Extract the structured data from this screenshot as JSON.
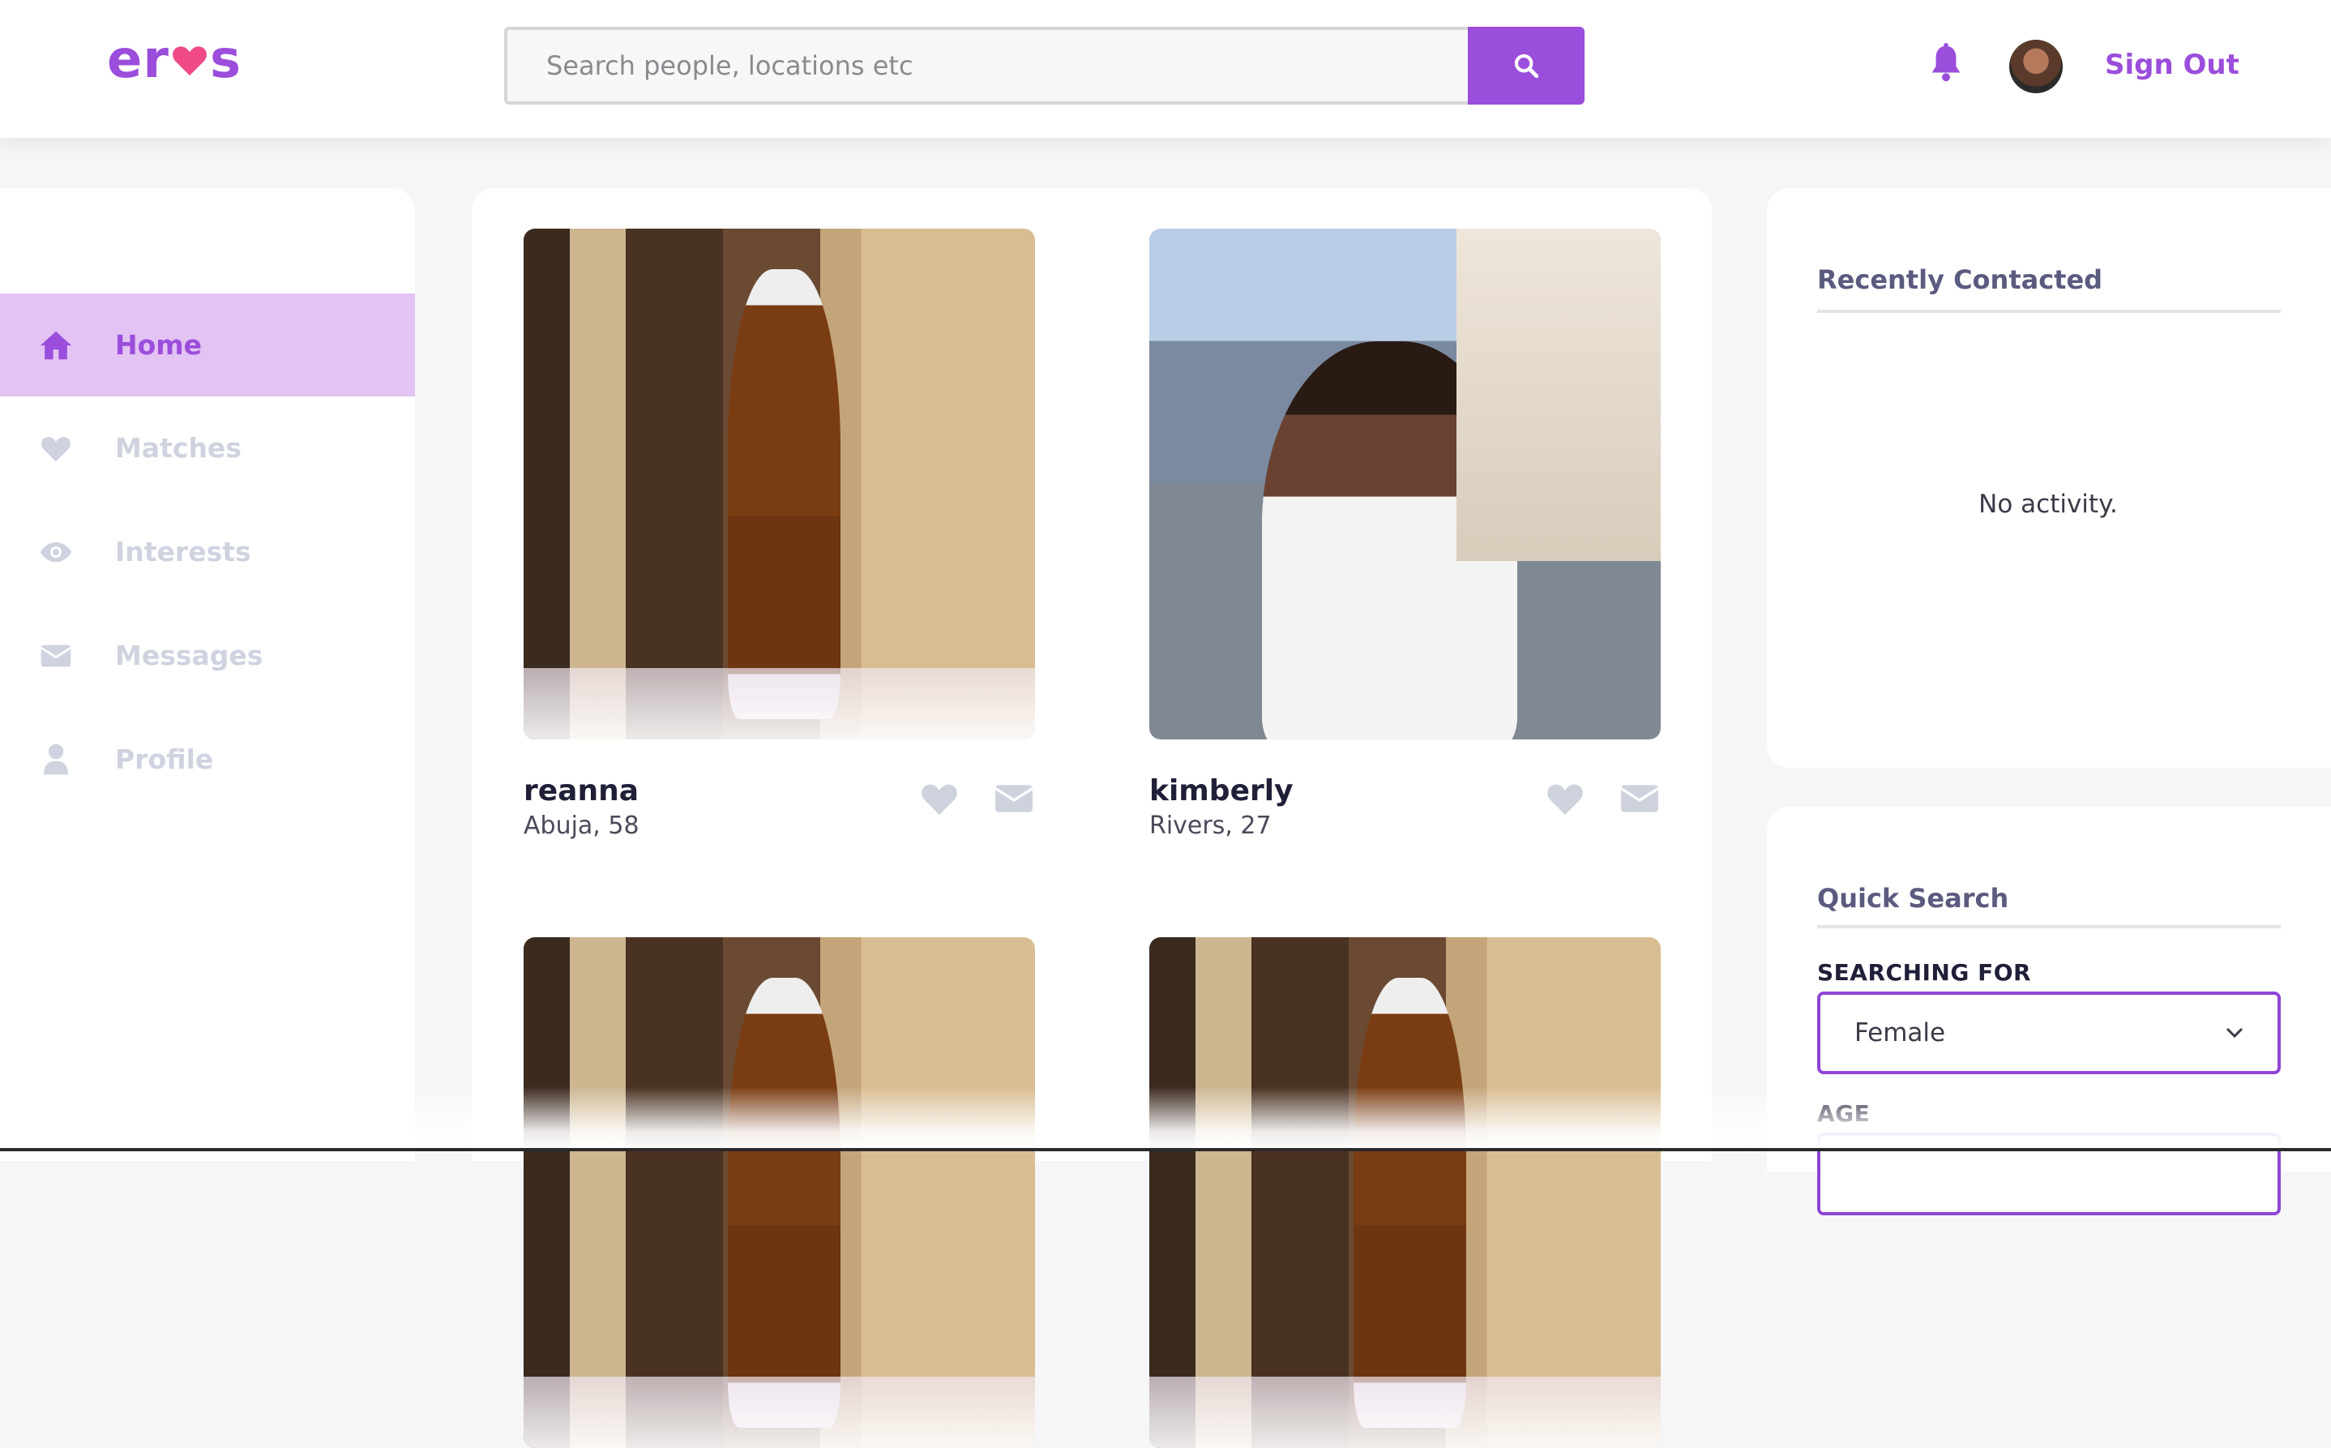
{
  "brand": {
    "name_part1": "er",
    "name_part2": "s",
    "accent": "#9b4ddb"
  },
  "header": {
    "search_placeholder": "Search people, locations etc",
    "search_icon": "search-icon",
    "notification_icon": "bell-icon",
    "sign_out_label": "Sign Out"
  },
  "sidebar": {
    "items": [
      {
        "label": "Home",
        "icon": "home-icon",
        "active": true
      },
      {
        "label": "Matches",
        "icon": "heart-icon",
        "active": false
      },
      {
        "label": "Interests",
        "icon": "eye-icon",
        "active": false
      },
      {
        "label": "Messages",
        "icon": "envelope-icon",
        "active": false
      },
      {
        "label": "Profile",
        "icon": "user-icon",
        "active": false
      }
    ]
  },
  "feed": {
    "profiles": [
      {
        "name": "reanna",
        "meta": "Abuja, 58"
      },
      {
        "name": "kimberly",
        "meta": "Rivers, 27"
      }
    ]
  },
  "recent": {
    "title": "Recently Contacted",
    "empty_text": "No activity."
  },
  "quick_search": {
    "title": "Quick Search",
    "searching_for_label": "SEARCHING FOR",
    "searching_for_value": "Female",
    "age_label": "AGE"
  }
}
